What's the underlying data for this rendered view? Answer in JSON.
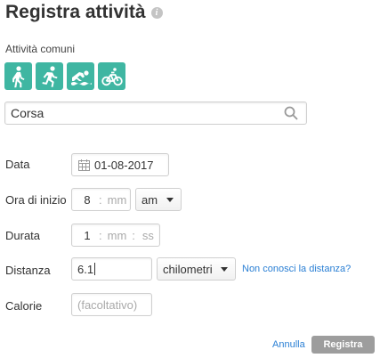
{
  "header": {
    "title": "Registra attività",
    "info_icon": "info-icon"
  },
  "common": {
    "label": "Attività comuni",
    "tile_color": "#3fb6a2",
    "tiles": [
      {
        "name": "walking",
        "icon": "walking-icon"
      },
      {
        "name": "running",
        "icon": "running-icon"
      },
      {
        "name": "swimming",
        "icon": "swimming-icon"
      },
      {
        "name": "cycling",
        "icon": "cycling-icon"
      }
    ]
  },
  "search": {
    "value": "Corsa",
    "icon": "search-icon"
  },
  "form": {
    "date": {
      "label": "Data",
      "value": "01-08-2017",
      "icon": "calendar-icon"
    },
    "start": {
      "label": "Ora di inizio",
      "hour": "8",
      "sep": ":",
      "minutes_placeholder": "mm",
      "ampm": "am"
    },
    "duration": {
      "label": "Durata",
      "hours": "1",
      "sep1": ":",
      "minutes_placeholder": "mm",
      "sep2": ":",
      "seconds_placeholder": "ss"
    },
    "distance": {
      "label": "Distanza",
      "value": "6.1",
      "unit": "chilometri",
      "help_link": "Non conosci la distanza?"
    },
    "calories": {
      "label": "Calorie",
      "placeholder": "(facoltativo)"
    }
  },
  "actions": {
    "cancel": "Annulla",
    "submit": "Registra",
    "submit_color": "#9d9d9d"
  }
}
